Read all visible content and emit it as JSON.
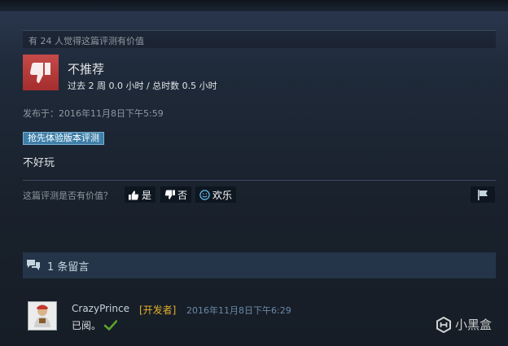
{
  "review": {
    "helpful_summary": "有 24 人觉得这篇评测有价值",
    "verdict": "不推荐",
    "hours": "过去 2 周 0.0 小时 / 总时数 0.5 小时",
    "posted": "发布于：2016年11月8日下午5:59",
    "badge": "抢先体验版本评测",
    "text": "不好玩",
    "verdict_color": "#b33434"
  },
  "helpful_prompt": {
    "question": "这篇评测是否有价值？",
    "yes_label": "是",
    "no_label": "否",
    "funny_label": "欢乐"
  },
  "comments": {
    "header": "1 条留言",
    "items": [
      {
        "author": "CrazyPrince",
        "tag": "[开发者]",
        "time": "2016年11月8日下午6:29",
        "text": "已阅。"
      }
    ]
  },
  "watermark": {
    "text": "小黑盒"
  },
  "icons": {
    "verdict": "thumbs-down-icon",
    "vote_yes": "thumbs-up-icon",
    "vote_no": "thumbs-down-icon",
    "vote_funny": "smiley-icon",
    "flag": "flag-icon",
    "comments": "speech-bubbles-icon",
    "check": "checkmark-icon",
    "watermark": "heybox-logo-icon"
  },
  "colors": {
    "accent_blue": "#3e7fa8",
    "developer_tag": "#e3b02a",
    "check_green": "#5ba32b"
  }
}
